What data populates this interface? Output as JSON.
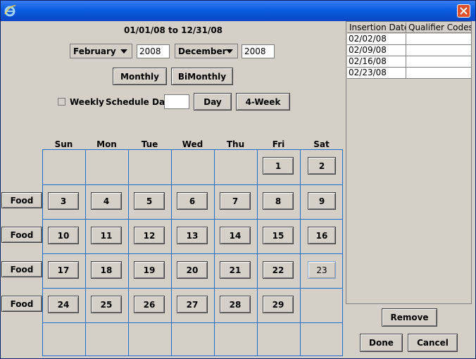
{
  "window": {
    "title": ""
  },
  "header": {
    "date_range": "01/01/08 to 12/31/08"
  },
  "range_selector": {
    "start_month": "February",
    "start_year": "2008",
    "end_month": "December",
    "end_year": "2008"
  },
  "buttons": {
    "monthly": "Monthly",
    "bimonthly": "BiMonthly",
    "weekly_label": "Weekly",
    "schedule_day_label": "Schedule Day",
    "schedule_day_value": "",
    "day": "Day",
    "four_week": "4-Week",
    "remove": "Remove",
    "done": "Done",
    "cancel": "Cancel"
  },
  "calendar": {
    "weekdays": [
      "Sun",
      "Mon",
      "Tue",
      "Wed",
      "Thu",
      "Fri",
      "Sat"
    ],
    "row_label": "Food",
    "weeks": [
      [
        "",
        "",
        "",
        "",
        "",
        "1",
        "2"
      ],
      [
        "3",
        "4",
        "5",
        "6",
        "7",
        "8",
        "9"
      ],
      [
        "10",
        "11",
        "12",
        "13",
        "14",
        "15",
        "16"
      ],
      [
        "17",
        "18",
        "19",
        "20",
        "21",
        "22",
        "23"
      ],
      [
        "24",
        "25",
        "26",
        "27",
        "28",
        "29",
        ""
      ],
      [
        "",
        "",
        "",
        "",
        "",
        "",
        ""
      ]
    ],
    "focused_day": "23"
  },
  "insertions": {
    "columns": [
      "Insertion Date",
      "Qualifier Codes"
    ],
    "rows": [
      [
        "02/02/08",
        ""
      ],
      [
        "02/09/08",
        ""
      ],
      [
        "02/16/08",
        ""
      ],
      [
        "02/23/08",
        ""
      ]
    ]
  },
  "colors": {
    "title_bar": "#0a5ce0",
    "grid_lines": "#1f6fd1",
    "close_button": "#e0502b"
  }
}
